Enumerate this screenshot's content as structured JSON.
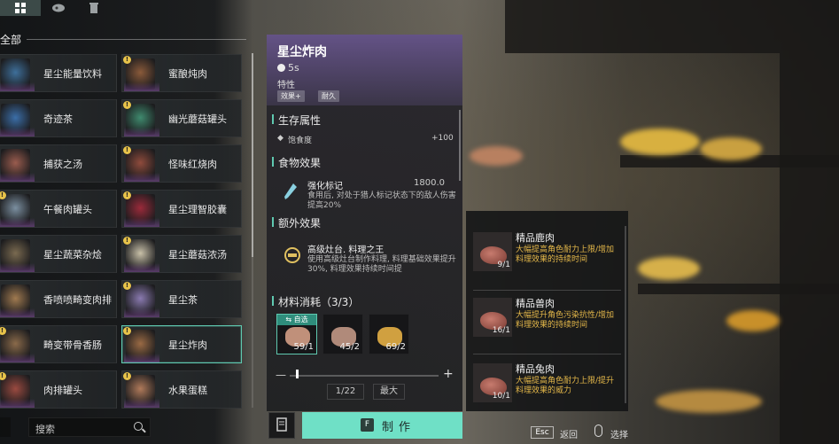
{
  "tabs": [
    {
      "icon": "grid-icon",
      "active": true
    },
    {
      "icon": "meat-icon",
      "active": false
    },
    {
      "icon": "trash-icon",
      "active": false
    }
  ],
  "category": "全部",
  "items": [
    {
      "name": "星尘能量饮料",
      "badge": false,
      "selected": false,
      "thumb": "#3e6f9a"
    },
    {
      "name": "蜜酿炖肉",
      "badge": true,
      "selected": false,
      "thumb": "#8a5a3a"
    },
    {
      "name": "奇迹茶",
      "badge": false,
      "selected": false,
      "thumb": "#3b6ea8"
    },
    {
      "name": "幽光蘑菇罐头",
      "badge": true,
      "selected": false,
      "thumb": "#3f8a6e"
    },
    {
      "name": "捕获之汤",
      "badge": false,
      "selected": false,
      "thumb": "#9a5c4e"
    },
    {
      "name": "怪味红烧肉",
      "badge": true,
      "selected": false,
      "thumb": "#8f4b3c"
    },
    {
      "name": "午餐肉罐头",
      "badge": true,
      "selected": false,
      "thumb": "#7b8fa0"
    },
    {
      "name": "星尘理智胶囊",
      "badge": true,
      "selected": false,
      "thumb": "#9a2a3a"
    },
    {
      "name": "星尘蔬菜杂烩",
      "badge": false,
      "selected": false,
      "thumb": "#7a6a50"
    },
    {
      "name": "星尘蘑菇浓汤",
      "badge": true,
      "selected": false,
      "thumb": "#c8c0a8"
    },
    {
      "name": "香喷喷畸变肉排",
      "badge": false,
      "selected": false,
      "thumb": "#a07a50"
    },
    {
      "name": "星尘茶",
      "badge": true,
      "selected": false,
      "thumb": "#8a7ab0"
    },
    {
      "name": "畸变带骨香肠",
      "badge": true,
      "selected": false,
      "thumb": "#8a6a4a"
    },
    {
      "name": "星尘炸肉",
      "badge": true,
      "selected": true,
      "thumb": "#9a6a44"
    },
    {
      "name": "肉排罐头",
      "badge": true,
      "selected": false,
      "thumb": "#9a4a40"
    },
    {
      "name": "水果蛋糕",
      "badge": true,
      "selected": false,
      "thumb": "#b07a5a"
    }
  ],
  "search": {
    "placeholder": "搜索"
  },
  "detail": {
    "title": "星尘炸肉",
    "time": "5s",
    "trait_label": "特性",
    "tags": [
      "效果+",
      "耐久"
    ],
    "survival_title": "生存属性",
    "satiety_label": "饱食度",
    "satiety_value": "+100",
    "food_effect_title": "食物效果",
    "food_effect_name": "强化标记",
    "food_effect_value": "1800.0",
    "food_effect_desc": "食用后, 对处于猎人标记状态下的敌人伤害提高20%",
    "extra_title": "额外效果",
    "extra_name": "高级灶台. 料理之王",
    "extra_desc": "使用高级灶台制作料理, 料理基础效果提升30%, 料理效果持续时间提",
    "materials_title": "材料消耗（3/3）",
    "materials": [
      {
        "count": "59/1",
        "auto_label": "自选",
        "selected": true,
        "color": "#c0907a"
      },
      {
        "count": "45/2",
        "auto_label": "",
        "selected": false,
        "color": "#b08a7a"
      },
      {
        "count": "69/2",
        "auto_label": "",
        "selected": false,
        "color": "#d0a040"
      }
    ],
    "quantity": "1/22",
    "max_label": "最大",
    "make_key": "F",
    "make_label": "制作"
  },
  "ingredients": [
    {
      "name": "精品鹿肉",
      "count": "9/1",
      "desc": "大幅提高角色耐力上限/增加料理效果的持续时间"
    },
    {
      "name": "精品兽肉",
      "count": "16/1",
      "desc": "大幅提升角色污染抗性/增加料理效果的持续时间"
    },
    {
      "name": "精品兔肉",
      "count": "10/1",
      "desc": "大幅提高角色耐力上限/提升料理效果的威力"
    }
  ],
  "hints": {
    "esc_key": "Esc",
    "esc_label": "返回",
    "select_label": "选择"
  },
  "colors": {
    "accent": "#6fe0c6",
    "selection": "#5fc9b0",
    "desc_gold": "#e6b94a",
    "header_purple": "#6e5a96"
  }
}
